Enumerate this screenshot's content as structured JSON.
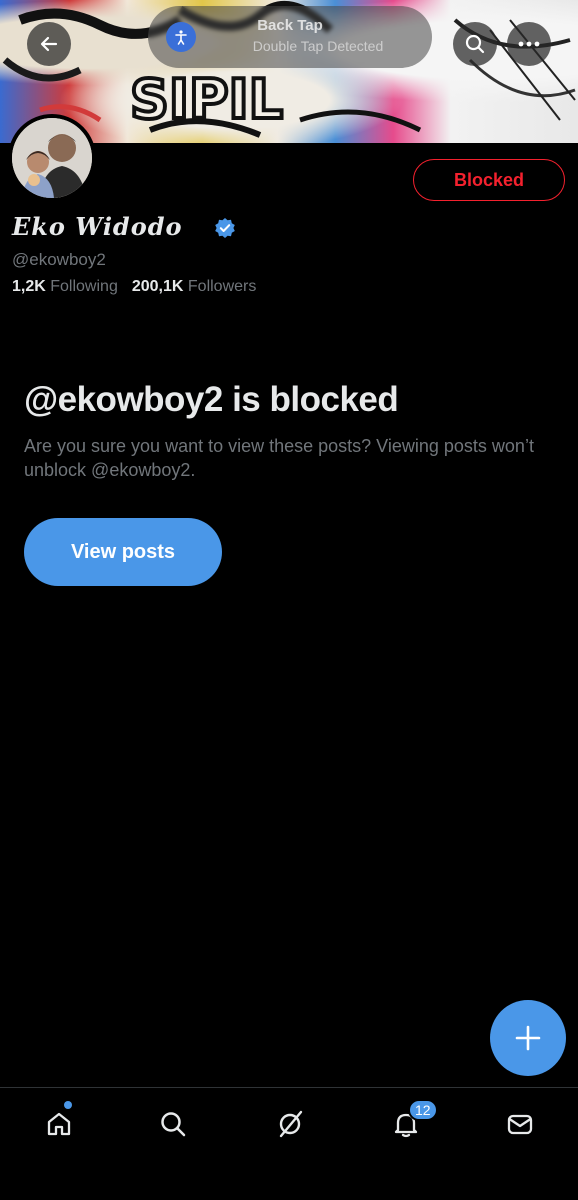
{
  "banner": {
    "overlay_title": "Back Tap",
    "overlay_subtitle": "Double Tap Detected",
    "graffiti_text": "SIPIL"
  },
  "profile": {
    "name": "Eko Widodo",
    "handle": "@ekowboy2",
    "following_count": "1,2K",
    "following_label": "Following",
    "followers_count": "200,1K",
    "followers_label": "Followers",
    "blocked_button_label": "Blocked"
  },
  "blocked_notice": {
    "title": "@ekowboy2 is blocked",
    "description": "Are you sure you want to view these posts? Viewing posts won’t unblock @ekowboy2.",
    "view_button_label": "View posts"
  },
  "bottom_nav": {
    "items": [
      "home-icon",
      "search-icon",
      "grok-icon",
      "notifications-icon",
      "messages-icon"
    ],
    "notification_badge": "12"
  },
  "colors": {
    "accent": "#4a97e8",
    "danger": "#f4212e",
    "muted_text": "#71767b",
    "background": "#000000"
  }
}
